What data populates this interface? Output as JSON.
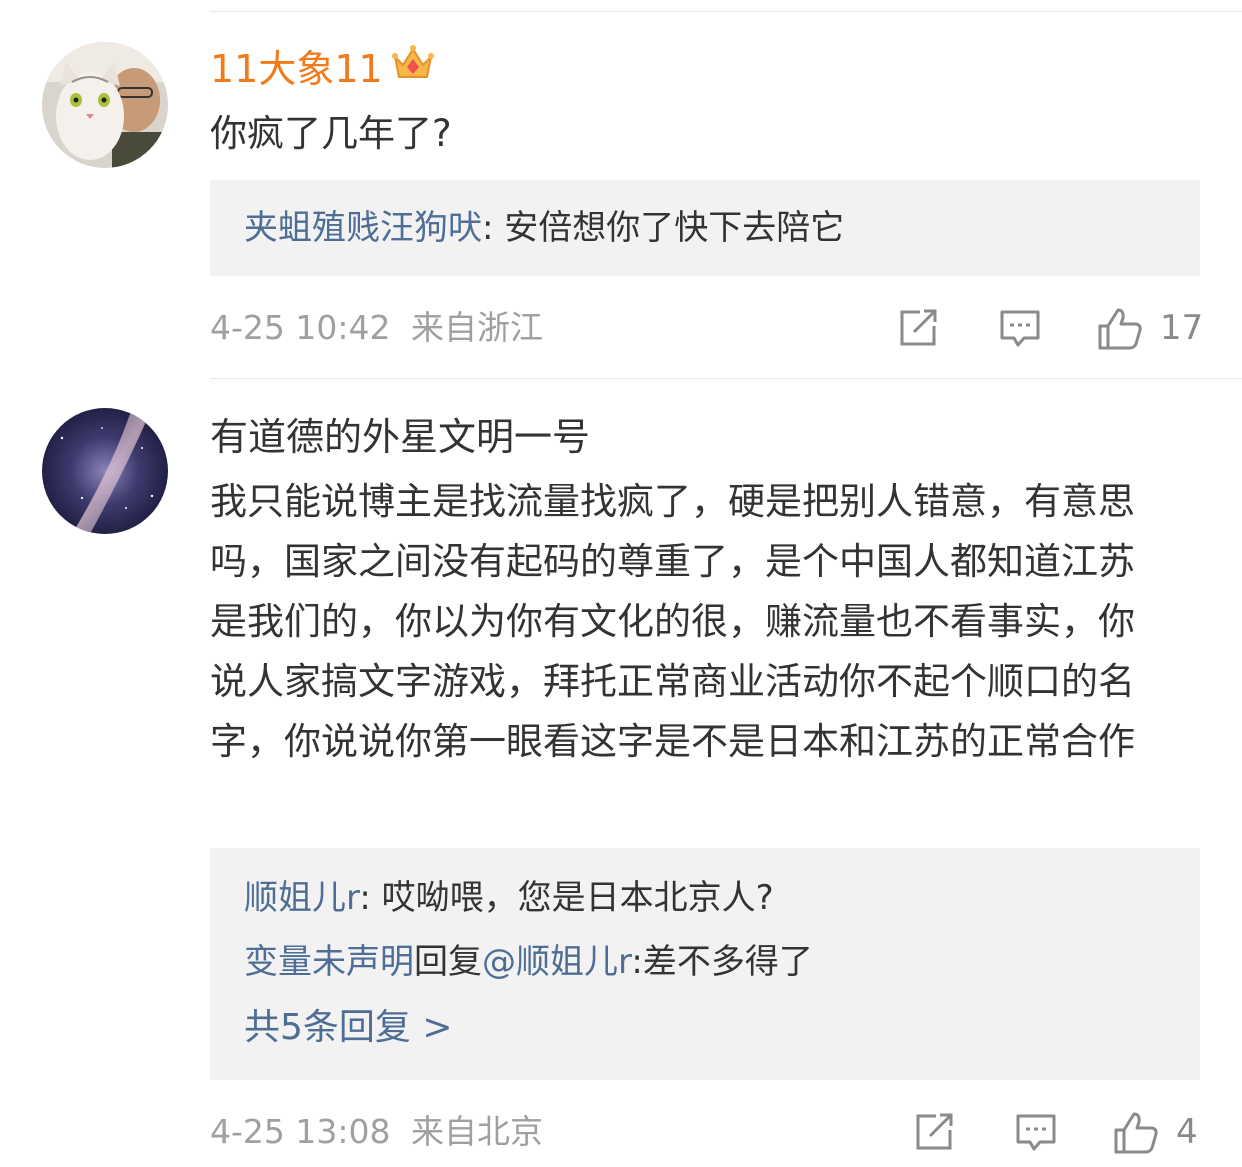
{
  "comments": [
    {
      "username": "11大象11",
      "user_style": "vip",
      "text": "你疯了几年了?",
      "replies": [
        {
          "author": "夹蛆殖贱汪狗吠",
          "text": ": 安倍想你了快下去陪它"
        }
      ],
      "more_replies": "",
      "time": "4-25 10:42",
      "source": "来自浙江",
      "likes": "17"
    },
    {
      "username": "有道德的外星文明一号",
      "user_style": "normal",
      "text": "我只能说博主是找流量找疯了，硬是把别人错意，有意思吗，国家之间没有起码的尊重了，是个中国人都知道江苏是我们的，你以为你有文化的很，赚流量也不看事实，你说人家搞文字游戏，拜托正常商业活动你不起个顺口的名字，你说说你第一眼看这字是不是日本和江苏的正常合作",
      "replies": [
        {
          "author": "顺姐儿r",
          "text": ": 哎呦喂，您是日本北京人?"
        },
        {
          "author": "变量未声明",
          "mid": "回复",
          "mention": "@顺姐儿r",
          "text": ":差不多得了"
        }
      ],
      "more_replies": "共5条回复 >",
      "time": "4-25 13:08",
      "source": "来自北京",
      "likes": "4"
    }
  ],
  "icons": {
    "crown": "crown-icon",
    "share": "share-icon",
    "comment": "comment-icon",
    "like": "thumbs-up-icon"
  },
  "colors": {
    "username_vip": "#f27a1a",
    "link_blue": "#4e6e96",
    "meta_gray": "#a0a0a0",
    "reply_bg": "#f2f2f2"
  }
}
